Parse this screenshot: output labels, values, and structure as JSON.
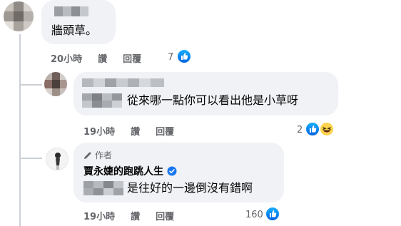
{
  "comments": [
    {
      "text": "牆頭草。",
      "time": "20小時",
      "like_label": "讚",
      "reply_label": "回覆",
      "reaction_count": "7",
      "reactions": [
        "like-icon"
      ]
    },
    {
      "text": "從來哪一點你可以看出他是小草呀",
      "time": "19小時",
      "like_label": "讚",
      "reply_label": "回覆",
      "reaction_count": "2",
      "reactions": [
        "like-icon",
        "haha-icon"
      ]
    },
    {
      "author_badge": "作者",
      "author_name": "賈永婕的跑跳人生",
      "text": "是往好的一邊倒沒有錯啊",
      "time": "19小時",
      "like_label": "讚",
      "reply_label": "回覆",
      "reaction_count": "160",
      "reactions": [
        "like-icon"
      ]
    }
  ],
  "colors": {
    "bubble": "#f0f2f5",
    "meta_text": "#65676b",
    "like_blue": "#1877f2",
    "thread_line": "#ccd0d5"
  }
}
